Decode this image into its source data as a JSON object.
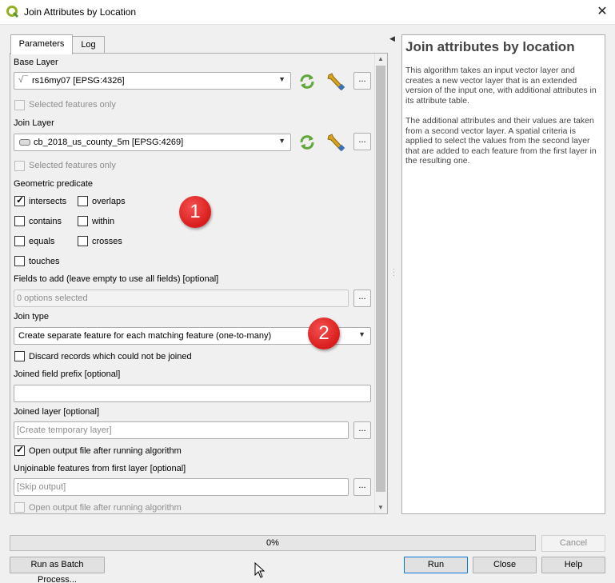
{
  "window": {
    "title": "Join Attributes by Location",
    "close_glyph": "✕",
    "icon": "qgis-icon"
  },
  "tabs": [
    {
      "label": "Parameters",
      "active": true
    },
    {
      "label": "Log",
      "active": false
    }
  ],
  "params": {
    "base_layer_label": "Base Layer",
    "base_layer_value": "rs16my07 [EPSG:4326]",
    "base_selected_only": "Selected features only",
    "join_layer_label": "Join Layer",
    "join_layer_value": "cb_2018_us_county_5m [EPSG:4269]",
    "join_selected_only": "Selected features only",
    "geometric_predicate_label": "Geometric predicate",
    "predicates": {
      "intersects": "intersects",
      "overlaps": "overlaps",
      "contains": "contains",
      "within": "within",
      "equals": "equals",
      "crosses": "crosses",
      "touches": "touches"
    },
    "fields_to_add_label": "Fields to add (leave empty to use all fields) [optional]",
    "fields_to_add_value": "0 options selected",
    "join_type_label": "Join type",
    "join_type_value": "Create separate feature for each matching feature (one-to-many)",
    "discard_label": "Discard records which could not be joined",
    "prefix_label": "Joined field prefix [optional]",
    "prefix_value": "",
    "joined_layer_label": "Joined layer [optional]",
    "joined_layer_placeholder": "[Create temporary layer]",
    "open_output_label": "Open output file after running algorithm",
    "unjoinable_label": "Unjoinable features from first layer [optional]",
    "unjoinable_placeholder": "[Skip output]",
    "open_output2_label": "Open output file after running algorithm",
    "dots": "..."
  },
  "callouts": [
    "1",
    "2"
  ],
  "help": {
    "title": "Join attributes by location",
    "p1": "This algorithm takes an input vector layer and creates a new vector layer that is an extended version of the input one, with additional attributes in its attribute table.",
    "p2": "The additional attributes and their values are taken from a second vector layer. A spatial criteria is applied to select the values from the second layer that are added to each feature from the first layer in the resulting one."
  },
  "progress": {
    "text": "0%",
    "value": 0
  },
  "buttons": {
    "cancel": "Cancel",
    "batch": "Run as Batch Process...",
    "run": "Run",
    "close": "Close",
    "help": "Help"
  }
}
